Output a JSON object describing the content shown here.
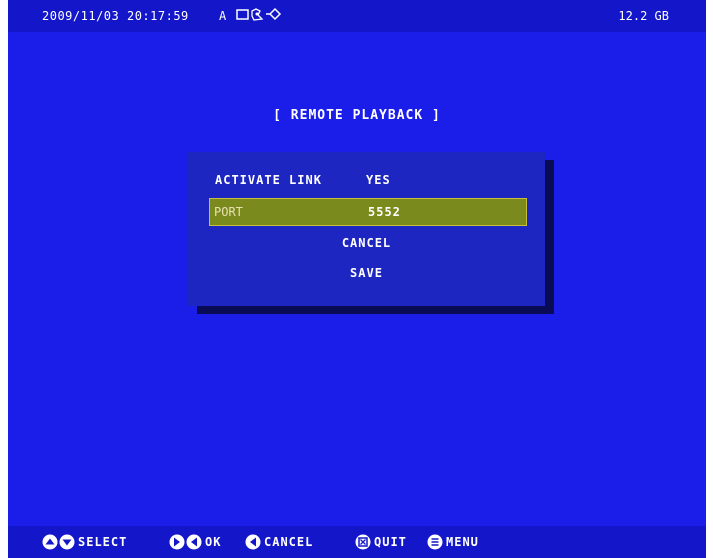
{
  "topbar": {
    "datetime": "2009/11/03 20:17:59",
    "mode": "A",
    "status_icons": [
      "screen-icon",
      "recording-icon",
      "network-icon"
    ],
    "disk": "12.2 GB"
  },
  "screen": {
    "title": "[ REMOTE PLAYBACK ]"
  },
  "dialog": {
    "activate_link_label": "ACTIVATE LINK",
    "activate_link_value": "YES",
    "port_label": "PORT",
    "port_value": "5552",
    "cancel_label": "CANCEL",
    "save_label": "SAVE"
  },
  "bottombar": {
    "select_label": "SELECT",
    "ok_label": "OK",
    "cancel_label": "CANCEL",
    "quit_label": "QUIT",
    "menu_label": "MENU"
  },
  "colors": {
    "background": "#1a1ee8",
    "dialog": "#1e26c2",
    "selection": "#7a8a1c",
    "text": "#ffffff"
  }
}
